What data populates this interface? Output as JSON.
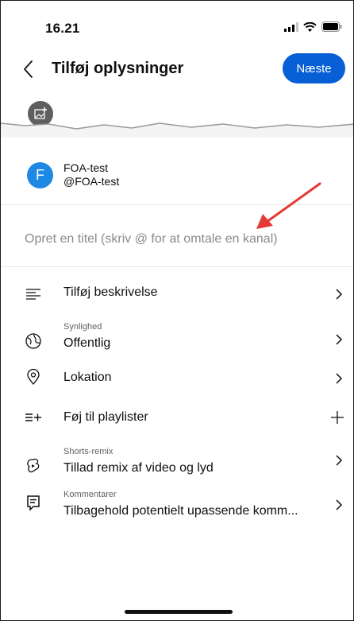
{
  "status_bar": {
    "time": "16.21"
  },
  "header": {
    "title": "Tilføj oplysninger",
    "next_label": "Næste"
  },
  "account": {
    "avatar_letter": "F",
    "name": "FOA-test",
    "handle": "@FOA-test"
  },
  "title_field": {
    "placeholder": "Opret en titel (skriv @ for at omtale en kanal)",
    "value": ""
  },
  "rows": {
    "description": {
      "label": "Tilføj beskrivelse"
    },
    "visibility": {
      "sublabel": "Synlighed",
      "label": "Offentlig"
    },
    "location": {
      "label": "Lokation"
    },
    "playlist": {
      "label": "Føj til playlister"
    },
    "remix": {
      "sublabel": "Shorts-remix",
      "label": "Tillad remix af video og lyd"
    },
    "comments": {
      "sublabel": "Kommentarer",
      "label": "Tilbagehold potentielt upassende komm..."
    }
  },
  "colors": {
    "accent": "#065fd4",
    "avatar": "#1e88e5",
    "annotation_arrow": "#e53935"
  },
  "icons": [
    "back-chevron-icon",
    "add-thumbnail-icon",
    "description-icon",
    "globe-icon",
    "location-pin-icon",
    "playlist-add-icon",
    "remix-icon",
    "comment-icon",
    "chevron-right-icon",
    "plus-icon"
  ]
}
